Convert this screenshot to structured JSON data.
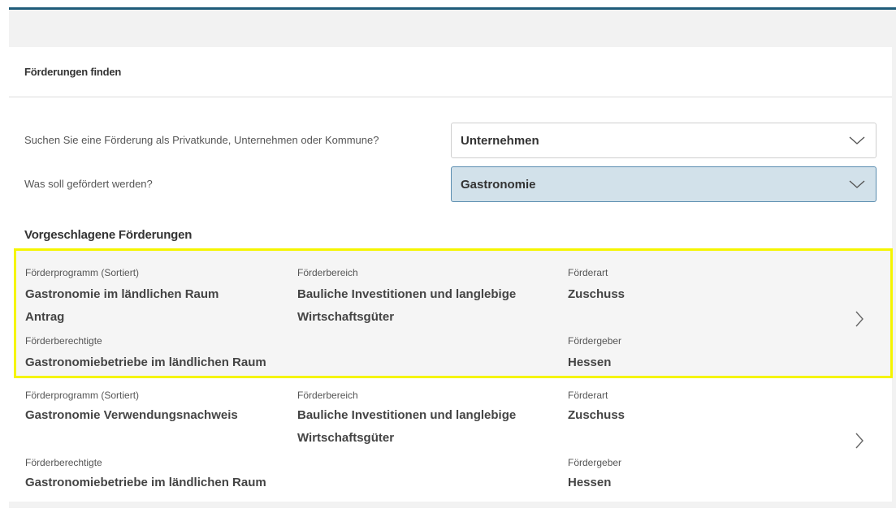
{
  "panel": {
    "title": "Förderungen finden"
  },
  "questions": [
    {
      "label": "Suchen Sie eine Förderung als Privatkunde, Unternehmen oder Kommune?",
      "value": "Unternehmen"
    },
    {
      "label": "Was soll gefördert werden?",
      "value": "Gastronomie"
    }
  ],
  "results": {
    "title": "Vorgeschlagene Förderungen",
    "items": [
      {
        "program_label": "Förderprogramm (Sortiert)",
        "program_value_1": "Gastronomie im ländlichen Raum",
        "program_value_2": "Antrag",
        "area_label": "Förderbereich",
        "area_value_1": "Bauliche Investitionen und langlebige",
        "area_value_2": "Wirtschaftsgüter",
        "type_label": "Förderart",
        "type_value": "Zuschuss",
        "eligible_label": "Förderberechtigte",
        "eligible_value": "Gastronomiebetriebe im ländlichen Raum",
        "funder_label": "Fördergeber",
        "funder_value": "Hessen"
      },
      {
        "program_label": "Förderprogramm (Sortiert)",
        "program_value_1": "Gastronomie Verwendungsnachweis",
        "area_label": "Förderbereich",
        "area_value_1": "Bauliche Investitionen und langlebige",
        "area_value_2": "Wirtschaftsgüter",
        "type_label": "Förderart",
        "type_value": "Zuschuss",
        "eligible_label": "Förderberechtigte",
        "eligible_value": "Gastronomiebetriebe im ländlichen Raum",
        "funder_label": "Fördergeber",
        "funder_value": "Hessen"
      }
    ]
  },
  "colors": {
    "accent_bar": "#1f5c7a",
    "highlight_border": "#f5f500",
    "active_select_bg": "#d2e1ea",
    "active_select_border": "#5a8db0"
  },
  "icons": {
    "select_chevron": "chevron-down-icon",
    "card_chevron": "chevron-right-icon"
  }
}
